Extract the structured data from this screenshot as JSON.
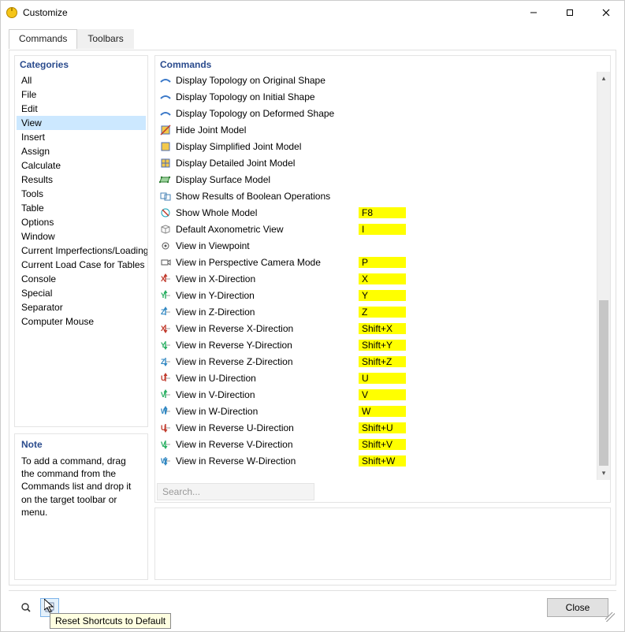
{
  "window": {
    "title": "Customize"
  },
  "tabs": {
    "commands": "Commands",
    "toolbars": "Toolbars"
  },
  "categories": {
    "title": "Categories",
    "items": [
      "All",
      "File",
      "Edit",
      "View",
      "Insert",
      "Assign",
      "Calculate",
      "Results",
      "Tools",
      "Table",
      "Options",
      "Window",
      "Current Imperfections/Loading",
      "Current Load Case for Tables",
      "Console",
      "Special",
      "Separator",
      "Computer Mouse"
    ],
    "selected": "View"
  },
  "note": {
    "title": "Note",
    "text": "To add a command, drag the command from the Commands list and drop it on the target toolbar or menu."
  },
  "commands": {
    "title": "Commands",
    "items": [
      {
        "label": "Display Topology on Original Shape",
        "shortcut": "",
        "icon": "shape-icon"
      },
      {
        "label": "Display Topology on Initial Shape",
        "shortcut": "",
        "icon": "shape-icon"
      },
      {
        "label": "Display Topology on Deformed Shape",
        "shortcut": "",
        "icon": "shape-icon"
      },
      {
        "label": "Hide Joint Model",
        "shortcut": "",
        "icon": "joint-hide-icon"
      },
      {
        "label": "Display Simplified Joint Model",
        "shortcut": "",
        "icon": "joint-simple-icon"
      },
      {
        "label": "Display Detailed Joint Model",
        "shortcut": "",
        "icon": "joint-detail-icon"
      },
      {
        "label": "Display Surface Model",
        "shortcut": "",
        "icon": "surface-icon"
      },
      {
        "label": "Show Results of Boolean Operations",
        "shortcut": "",
        "icon": "boolean-icon"
      },
      {
        "label": "Show Whole Model",
        "shortcut": "F8",
        "icon": "model-icon"
      },
      {
        "label": "Default Axonometric View",
        "shortcut": "I",
        "icon": "axo-icon"
      },
      {
        "label": "View in Viewpoint",
        "shortcut": "",
        "icon": "viewpoint-icon"
      },
      {
        "label": "View in Perspective Camera Mode",
        "shortcut": "P",
        "icon": "camera-icon"
      },
      {
        "label": "View in X-Direction",
        "shortcut": "X",
        "icon": "x-dir-icon"
      },
      {
        "label": "View in Y-Direction",
        "shortcut": "Y",
        "icon": "y-dir-icon"
      },
      {
        "label": "View in Z-Direction",
        "shortcut": "Z",
        "icon": "z-dir-icon"
      },
      {
        "label": "View in Reverse X-Direction",
        "shortcut": "Shift+X",
        "icon": "x-rev-icon"
      },
      {
        "label": "View in Reverse Y-Direction",
        "shortcut": "Shift+Y",
        "icon": "y-rev-icon"
      },
      {
        "label": "View in Reverse Z-Direction",
        "shortcut": "Shift+Z",
        "icon": "z-rev-icon"
      },
      {
        "label": "View in U-Direction",
        "shortcut": "U",
        "icon": "u-dir-icon"
      },
      {
        "label": "View in V-Direction",
        "shortcut": "V",
        "icon": "v-dir-icon"
      },
      {
        "label": "View in W-Direction",
        "shortcut": "W",
        "icon": "w-dir-icon"
      },
      {
        "label": "View in Reverse U-Direction",
        "shortcut": "Shift+U",
        "icon": "u-rev-icon"
      },
      {
        "label": "View in Reverse V-Direction",
        "shortcut": "Shift+V",
        "icon": "v-rev-icon"
      },
      {
        "label": "View in Reverse W-Direction",
        "shortcut": "Shift+W",
        "icon": "w-rev-icon"
      }
    ]
  },
  "search": {
    "placeholder": "Search..."
  },
  "footer": {
    "close": "Close",
    "tooltip": "Reset Shortcuts to Default"
  }
}
